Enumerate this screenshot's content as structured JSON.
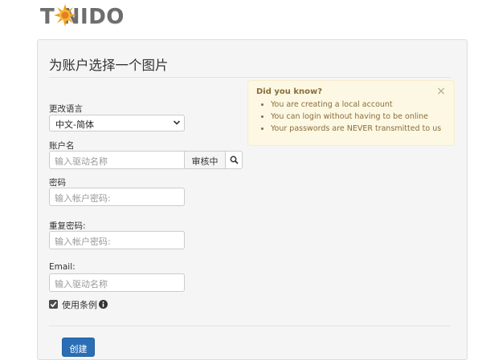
{
  "brand": {
    "logo_text": "T NIDO"
  },
  "page": {
    "title": "为账户选择一个图片"
  },
  "tip": {
    "title": "Did you know?",
    "close_icon": "close-icon",
    "items": [
      "You are creating a local account",
      "You can login without having to be online",
      "Your passwords are NEVER transmitted to us"
    ]
  },
  "form": {
    "language": {
      "label": "更改语言",
      "value": "中文-简体"
    },
    "account": {
      "label": "账户名",
      "placeholder": "输入驱动名称",
      "review_button": "审核中",
      "search_icon": "search-icon"
    },
    "password": {
      "label": "密码",
      "placeholder": "输入帐户密码:"
    },
    "repeat_password": {
      "label": "重复密码:",
      "placeholder": "输入帐户密码:"
    },
    "email": {
      "label": "Email:",
      "placeholder": "输入驱动名称"
    },
    "terms": {
      "label": "使用条例",
      "checked": true,
      "info_icon": "info-icon"
    },
    "submit": {
      "label": "创建"
    }
  },
  "colors": {
    "primary": "#2a6fb6",
    "alert_bg": "#fcf8e3",
    "alert_text": "#8a6d3b",
    "panel_bg": "#f5f5f5"
  }
}
